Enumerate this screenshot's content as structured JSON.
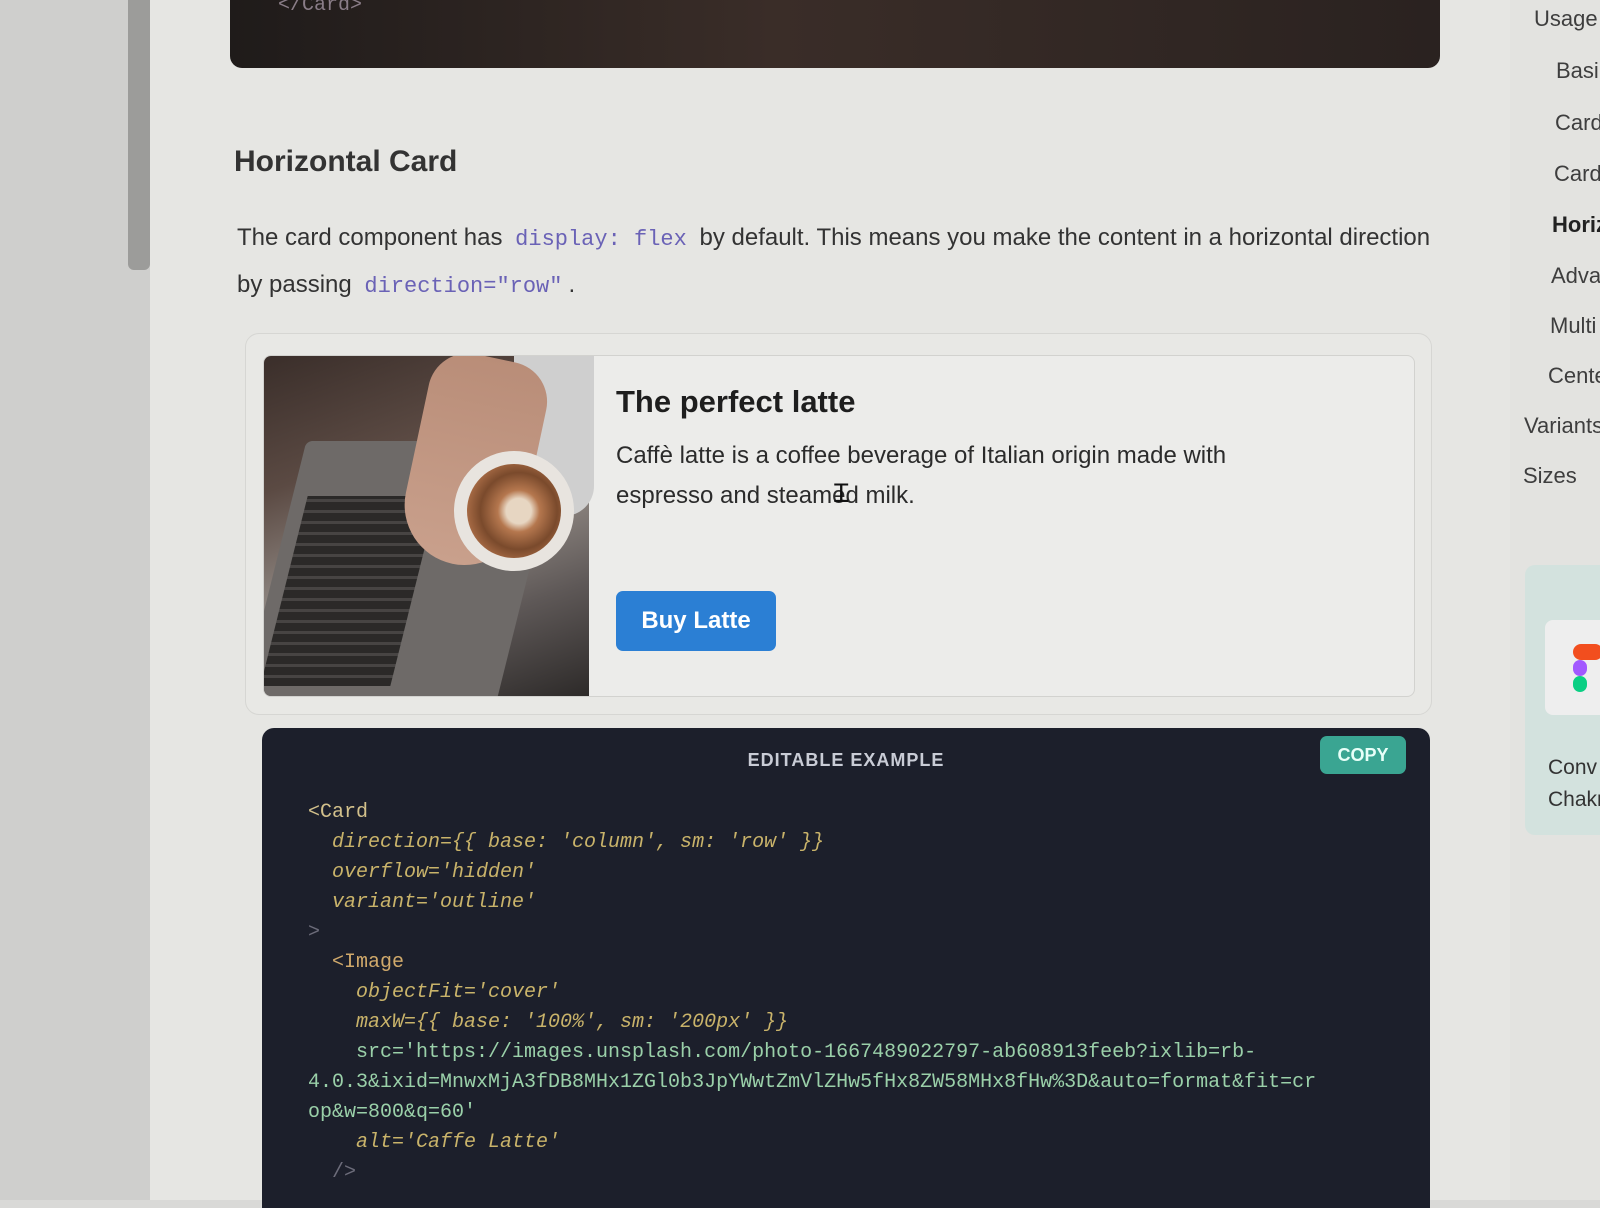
{
  "top_snippet": {
    "tag": "</Card>"
  },
  "section": {
    "title": "Horizontal Card",
    "intro_1": "The card component has",
    "intro_code_1": "display: flex",
    "intro_2": "by default. This means you make the content in a horizontal direction by passing",
    "intro_code_2": "direction=\"row\"",
    "intro_3": "."
  },
  "example_card": {
    "title": "The perfect latte",
    "description": "Caffè latte is a coffee beverage of Italian origin made with espresso and steamed milk.",
    "button_label": "Buy Latte"
  },
  "code_panel": {
    "label": "EDITABLE EXAMPLE",
    "copy_label": "COPY",
    "lines": [
      "<Card",
      "  direction={{ base: 'column', sm: 'row' }}",
      "  overflow='hidden'",
      "  variant='outline'",
      ">",
      "  <Image",
      "    objectFit='cover'",
      "    maxW={{ base: '100%', sm: '200px' }}",
      "    src='https://images.unsplash.com/photo-1667489022797-ab608913feeb?ixlib=rb-",
      "4.0.3&ixid=MnwxMjA3fDB8MHx1ZGl0b3JpYWwtZmVlZHw5fHx8ZW58MHx8fHw%3D&auto=format&fit=cr",
      "op&w=800&q=60'",
      "    alt='Caffe Latte'",
      "  />"
    ]
  },
  "toc": {
    "items": [
      {
        "label": "Usage",
        "active": false
      },
      {
        "label": "Basi",
        "active": false
      },
      {
        "label": "Card",
        "active": false
      },
      {
        "label": "Card",
        "active": false
      },
      {
        "label": "Horiz",
        "active": true
      },
      {
        "label": "Adva",
        "active": false
      },
      {
        "label": "Multi",
        "active": false
      },
      {
        "label": "Cente",
        "active": false
      },
      {
        "label": "Variants",
        "active": false
      },
      {
        "label": "Sizes",
        "active": false
      }
    ]
  },
  "ad": {
    "line_1": "Conv",
    "line_2": "Chakr",
    "icon": "figma-icon"
  },
  "colors": {
    "button_blue": "#2b7fd4",
    "copy_green": "#3aa592",
    "code_bg": "#1c1f2b",
    "inline_code": "#6a62b6"
  }
}
